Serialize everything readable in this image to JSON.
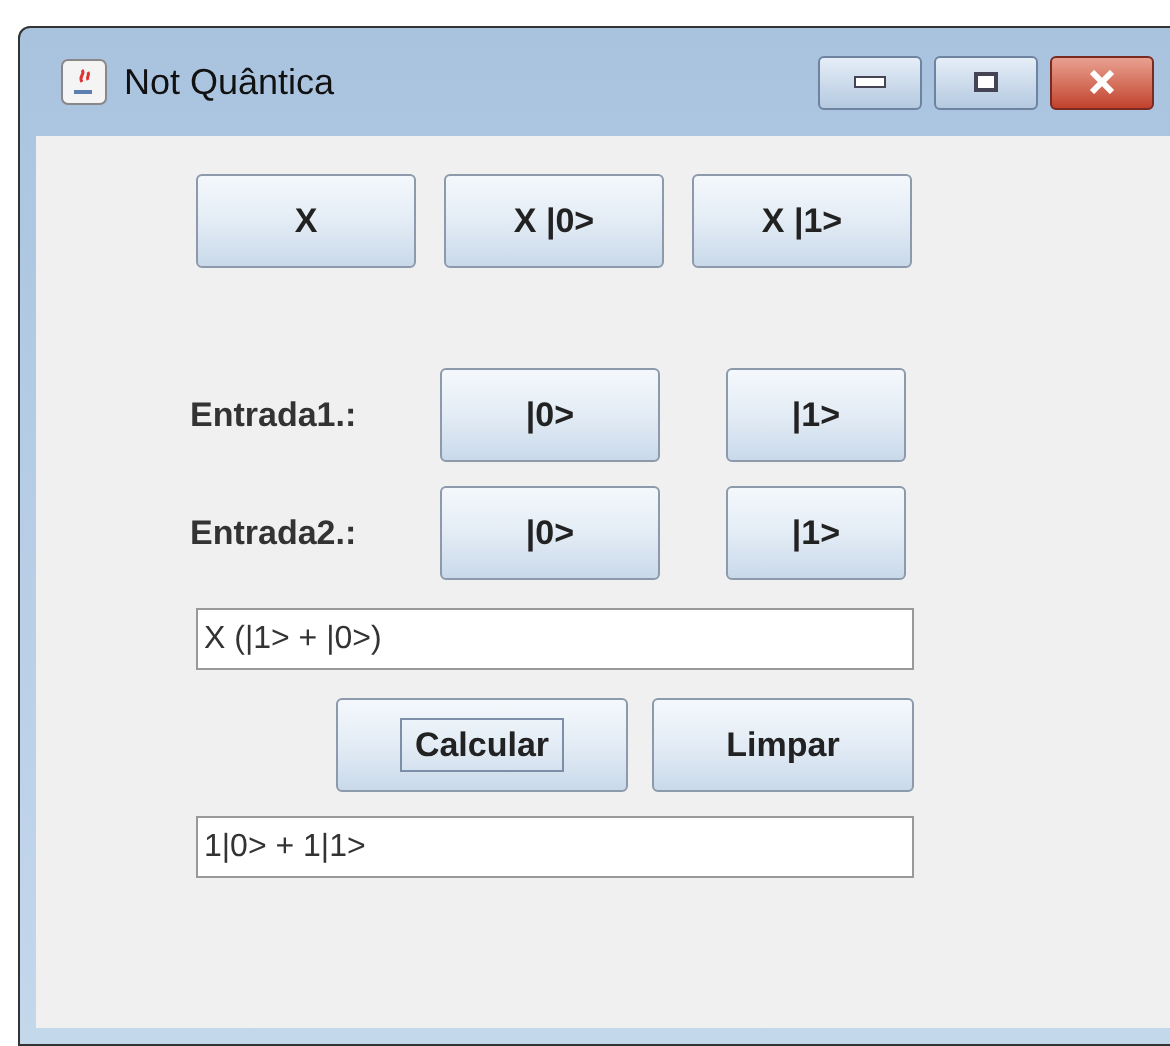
{
  "window": {
    "title": "Not Quântica"
  },
  "gate_buttons": [
    "X",
    "X |0>",
    "X |1>"
  ],
  "inputs": [
    {
      "label": "Entrada1.:",
      "buttons": [
        "|0>",
        "|1>"
      ]
    },
    {
      "label": "Entrada2.:",
      "buttons": [
        "|0>",
        "|1>"
      ]
    }
  ],
  "expression_field": {
    "value": "X (|1> + |0>)"
  },
  "actions": [
    {
      "label": "Calcular",
      "focused": true
    },
    {
      "label": "Limpar",
      "focused": false
    }
  ],
  "result_field": {
    "value": "1|0> + 1|1>"
  }
}
